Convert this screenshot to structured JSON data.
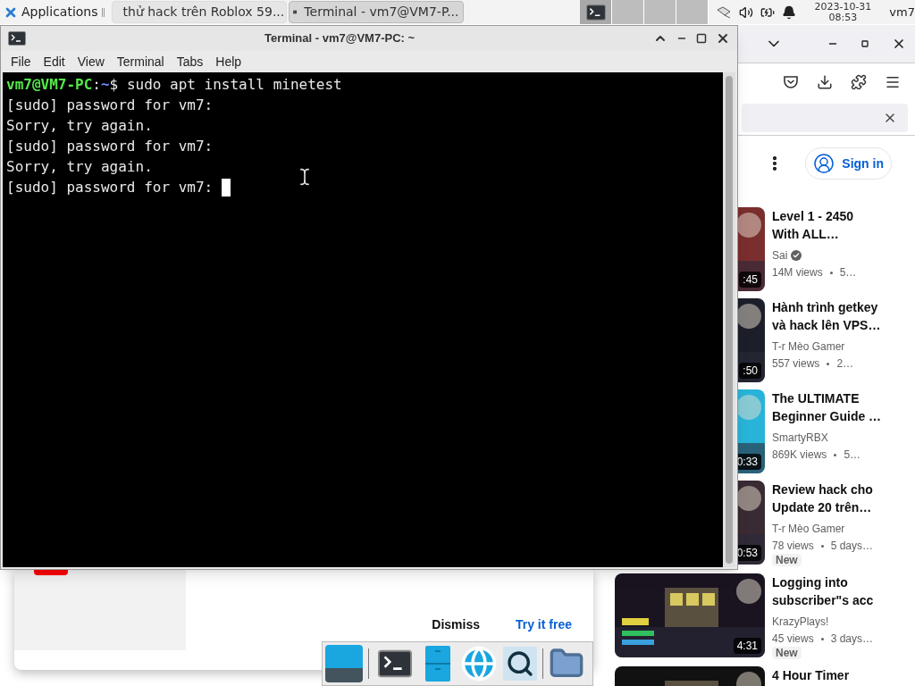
{
  "top_panel": {
    "applications": "Applications",
    "tasks": [
      {
        "kind": "browser",
        "title": "thử hack trên Roblox 59...",
        "selected": false
      },
      {
        "kind": "terminal",
        "title": "Terminal - vm7@VM7-P...",
        "selected": true
      }
    ],
    "workspaces": [
      {
        "selected": true
      },
      {
        "selected": false
      },
      {
        "selected": false
      },
      {
        "selected": false
      }
    ],
    "date": "2023-10-31",
    "time": "08:53",
    "user": "vm7"
  },
  "terminal": {
    "title": "Terminal - vm7@VM7-PC: ~",
    "menus": [
      "File",
      "Edit",
      "View",
      "Terminal",
      "Tabs",
      "Help"
    ],
    "lines": [
      {
        "kind": "prompt",
        "user_host": "vm7@VM7-PC",
        "separator": ":",
        "path": "~",
        "command": "$ sudo apt install minetest"
      },
      {
        "kind": "output",
        "text": "[sudo] password for vm7:"
      },
      {
        "kind": "output",
        "text": "Sorry, try again."
      },
      {
        "kind": "output",
        "text": "[sudo] password for vm7:"
      },
      {
        "kind": "output",
        "text": "Sorry, try again."
      },
      {
        "kind": "output",
        "text": "[sudo] password for vm7: "
      }
    ]
  },
  "browser": {
    "sign_in": "Sign in",
    "videos": [
      {
        "title_lines": [
          "Level 1 - 2450",
          "With ALL…"
        ],
        "channel": "Sai",
        "verified": true,
        "views": "14M views",
        "age": "5…",
        "duration": ":45"
      },
      {
        "title_lines": [
          "Hành trình getkey",
          "và hack lên VPS…"
        ],
        "channel": "T-r Mèo Gamer",
        "views": "557 views",
        "age": "2…",
        "duration": ":50"
      },
      {
        "title_lines": [
          "The ULTIMATE",
          "Beginner Guide …"
        ],
        "channel": "SmartyRBX",
        "views": "869K views",
        "age": "5…",
        "duration": "0:33"
      },
      {
        "title_lines": [
          "Review hack cho",
          "Update 20 trên…"
        ],
        "channel": "T-r Mèo Gamer",
        "views": "78 views",
        "age": "5 days…",
        "duration": "0:53",
        "badge": "New"
      },
      {
        "title_lines": [
          "Logging into",
          "subscriber\"s acc"
        ],
        "channel": "KrazyPlays!",
        "views": "45 views",
        "age": "3 days…",
        "duration": "4:31",
        "badge": "New"
      },
      {
        "title_lines": [
          "4 Hour Timer"
        ]
      }
    ],
    "promo": {
      "dismiss": "Dismiss",
      "try": "Try it free"
    }
  }
}
